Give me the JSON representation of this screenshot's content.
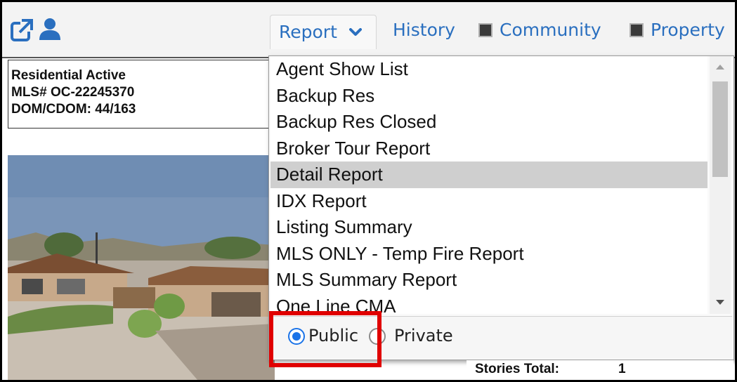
{
  "toolbar": {
    "tabs": {
      "report": "Report",
      "history": "History",
      "community": "Community",
      "property": "Property"
    },
    "icons": [
      "external-link-icon",
      "user-icon",
      "chevron-down-icon",
      "community-icon",
      "property-icon"
    ],
    "link_color": "#2a6fbf"
  },
  "listing": {
    "status": "Residential Active",
    "mls": "MLS# OC-22245370",
    "dom": "DOM/CDOM: 44/163"
  },
  "report_menu": {
    "items": [
      "Agent Show List",
      "Backup Res",
      "Backup Res Closed",
      "Broker Tour Report",
      "Detail Report",
      "IDX Report",
      "Listing Summary",
      "MLS ONLY - Temp Fire Report",
      "MLS Summary Report",
      "One Line CMA"
    ],
    "selected": "Detail Report",
    "visibility": {
      "public_label": "Public",
      "private_label": "Private",
      "selected": "Public"
    },
    "highlight_color": "#e00000"
  },
  "details": {
    "stories_label": "Stories Total:",
    "stories_value": "1"
  }
}
